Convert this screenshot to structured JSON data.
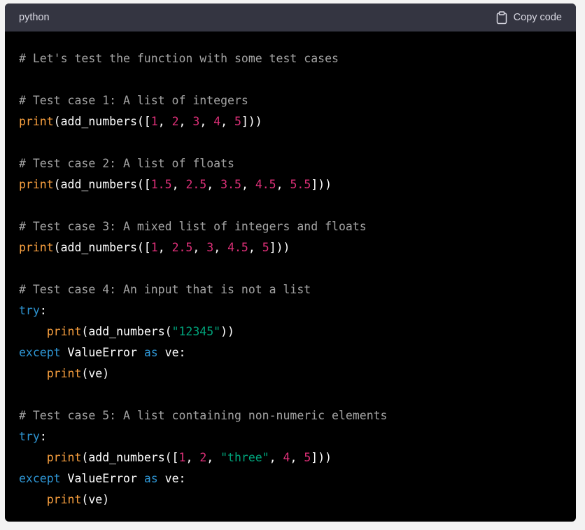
{
  "header": {
    "language": "python",
    "copy_label": "Copy code",
    "copy_icon": "clipboard-icon"
  },
  "colors": {
    "background": "#000000",
    "header_bg": "#343541",
    "comment": "#a3a3a3",
    "builtin": "#f9a03f",
    "number": "#df3079",
    "keyword": "#2e95d3",
    "string": "#00a67d",
    "plain": "#ffffff"
  },
  "code": {
    "lines": [
      [
        {
          "t": "# Let's test the function with some test cases",
          "c": "comment"
        }
      ],
      [],
      [
        {
          "t": "# Test case 1: A list of integers",
          "c": "comment"
        }
      ],
      [
        {
          "t": "print",
          "c": "builtin"
        },
        {
          "t": "(add_numbers([",
          "c": "plain"
        },
        {
          "t": "1",
          "c": "number"
        },
        {
          "t": ", ",
          "c": "plain"
        },
        {
          "t": "2",
          "c": "number"
        },
        {
          "t": ", ",
          "c": "plain"
        },
        {
          "t": "3",
          "c": "number"
        },
        {
          "t": ", ",
          "c": "plain"
        },
        {
          "t": "4",
          "c": "number"
        },
        {
          "t": ", ",
          "c": "plain"
        },
        {
          "t": "5",
          "c": "number"
        },
        {
          "t": "]))",
          "c": "plain"
        }
      ],
      [],
      [
        {
          "t": "# Test case 2: A list of floats",
          "c": "comment"
        }
      ],
      [
        {
          "t": "print",
          "c": "builtin"
        },
        {
          "t": "(add_numbers([",
          "c": "plain"
        },
        {
          "t": "1.5",
          "c": "number"
        },
        {
          "t": ", ",
          "c": "plain"
        },
        {
          "t": "2.5",
          "c": "number"
        },
        {
          "t": ", ",
          "c": "plain"
        },
        {
          "t": "3.5",
          "c": "number"
        },
        {
          "t": ", ",
          "c": "plain"
        },
        {
          "t": "4.5",
          "c": "number"
        },
        {
          "t": ", ",
          "c": "plain"
        },
        {
          "t": "5.5",
          "c": "number"
        },
        {
          "t": "]))",
          "c": "plain"
        }
      ],
      [],
      [
        {
          "t": "# Test case 3: A mixed list of integers and floats",
          "c": "comment"
        }
      ],
      [
        {
          "t": "print",
          "c": "builtin"
        },
        {
          "t": "(add_numbers([",
          "c": "plain"
        },
        {
          "t": "1",
          "c": "number"
        },
        {
          "t": ", ",
          "c": "plain"
        },
        {
          "t": "2.5",
          "c": "number"
        },
        {
          "t": ", ",
          "c": "plain"
        },
        {
          "t": "3",
          "c": "number"
        },
        {
          "t": ", ",
          "c": "plain"
        },
        {
          "t": "4.5",
          "c": "number"
        },
        {
          "t": ", ",
          "c": "plain"
        },
        {
          "t": "5",
          "c": "number"
        },
        {
          "t": "]))",
          "c": "plain"
        }
      ],
      [],
      [
        {
          "t": "# Test case 4: An input that is not a list",
          "c": "comment"
        }
      ],
      [
        {
          "t": "try",
          "c": "keyword"
        },
        {
          "t": ":",
          "c": "plain"
        }
      ],
      [
        {
          "t": "    ",
          "c": "plain"
        },
        {
          "t": "print",
          "c": "builtin"
        },
        {
          "t": "(add_numbers(",
          "c": "plain"
        },
        {
          "t": "\"12345\"",
          "c": "string"
        },
        {
          "t": "))",
          "c": "plain"
        }
      ],
      [
        {
          "t": "except",
          "c": "keyword"
        },
        {
          "t": " ValueError ",
          "c": "plain"
        },
        {
          "t": "as",
          "c": "keyword"
        },
        {
          "t": " ve:",
          "c": "plain"
        }
      ],
      [
        {
          "t": "    ",
          "c": "plain"
        },
        {
          "t": "print",
          "c": "builtin"
        },
        {
          "t": "(ve)",
          "c": "plain"
        }
      ],
      [],
      [
        {
          "t": "# Test case 5: A list containing non-numeric elements",
          "c": "comment"
        }
      ],
      [
        {
          "t": "try",
          "c": "keyword"
        },
        {
          "t": ":",
          "c": "plain"
        }
      ],
      [
        {
          "t": "    ",
          "c": "plain"
        },
        {
          "t": "print",
          "c": "builtin"
        },
        {
          "t": "(add_numbers([",
          "c": "plain"
        },
        {
          "t": "1",
          "c": "number"
        },
        {
          "t": ", ",
          "c": "plain"
        },
        {
          "t": "2",
          "c": "number"
        },
        {
          "t": ", ",
          "c": "plain"
        },
        {
          "t": "\"three\"",
          "c": "string"
        },
        {
          "t": ", ",
          "c": "plain"
        },
        {
          "t": "4",
          "c": "number"
        },
        {
          "t": ", ",
          "c": "plain"
        },
        {
          "t": "5",
          "c": "number"
        },
        {
          "t": "]))",
          "c": "plain"
        }
      ],
      [
        {
          "t": "except",
          "c": "keyword"
        },
        {
          "t": " ValueError ",
          "c": "plain"
        },
        {
          "t": "as",
          "c": "keyword"
        },
        {
          "t": " ve:",
          "c": "plain"
        }
      ],
      [
        {
          "t": "    ",
          "c": "plain"
        },
        {
          "t": "print",
          "c": "builtin"
        },
        {
          "t": "(ve)",
          "c": "plain"
        }
      ]
    ]
  }
}
